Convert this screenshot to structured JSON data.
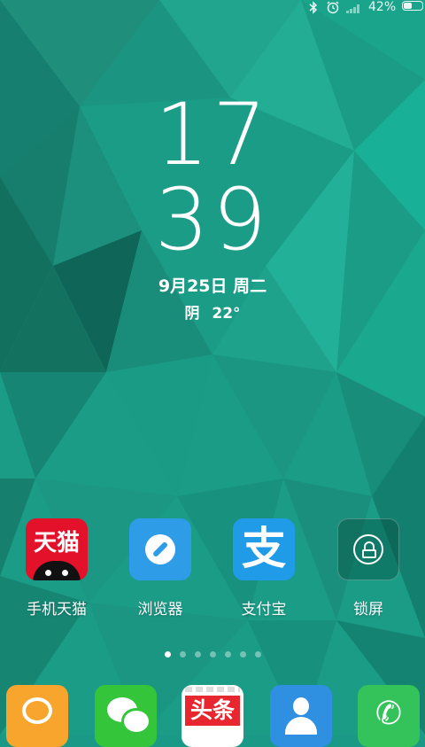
{
  "status_bar": {
    "bluetooth_icon": "bluetooth-icon",
    "alarm_icon": "alarm-icon",
    "signal_icon": "signal-icon",
    "battery_percent": "42%",
    "battery_level": 0.42
  },
  "lockscreen": {
    "hour": "17",
    "minute": "39",
    "date": "9月25日 周二",
    "weather": {
      "condition": "阴",
      "temperature": "22°"
    }
  },
  "apps": [
    {
      "label": "手机天猫",
      "icon": "tmall-icon",
      "icon_text": "天猫",
      "color": "#e4112b"
    },
    {
      "label": "浏览器",
      "icon": "browser-icon",
      "color": "#2e9ce6"
    },
    {
      "label": "支付宝",
      "icon": "alipay-icon",
      "icon_text": "支",
      "color": "#1f9be8"
    },
    {
      "label": "锁屏",
      "icon": "lock-icon"
    }
  ],
  "pager": {
    "page_count": 7,
    "active_page": 1
  },
  "dock": [
    {
      "icon": "messages-icon",
      "color": "#f7a52d"
    },
    {
      "icon": "wechat-icon",
      "color": "#35c53b"
    },
    {
      "icon": "toutiao-icon",
      "icon_text": "头条",
      "color": "#e8262f"
    },
    {
      "icon": "contacts-icon",
      "color": "#2f8fe0"
    },
    {
      "icon": "phone-icon",
      "glyph": "✆",
      "color": "#34c25a"
    }
  ]
}
